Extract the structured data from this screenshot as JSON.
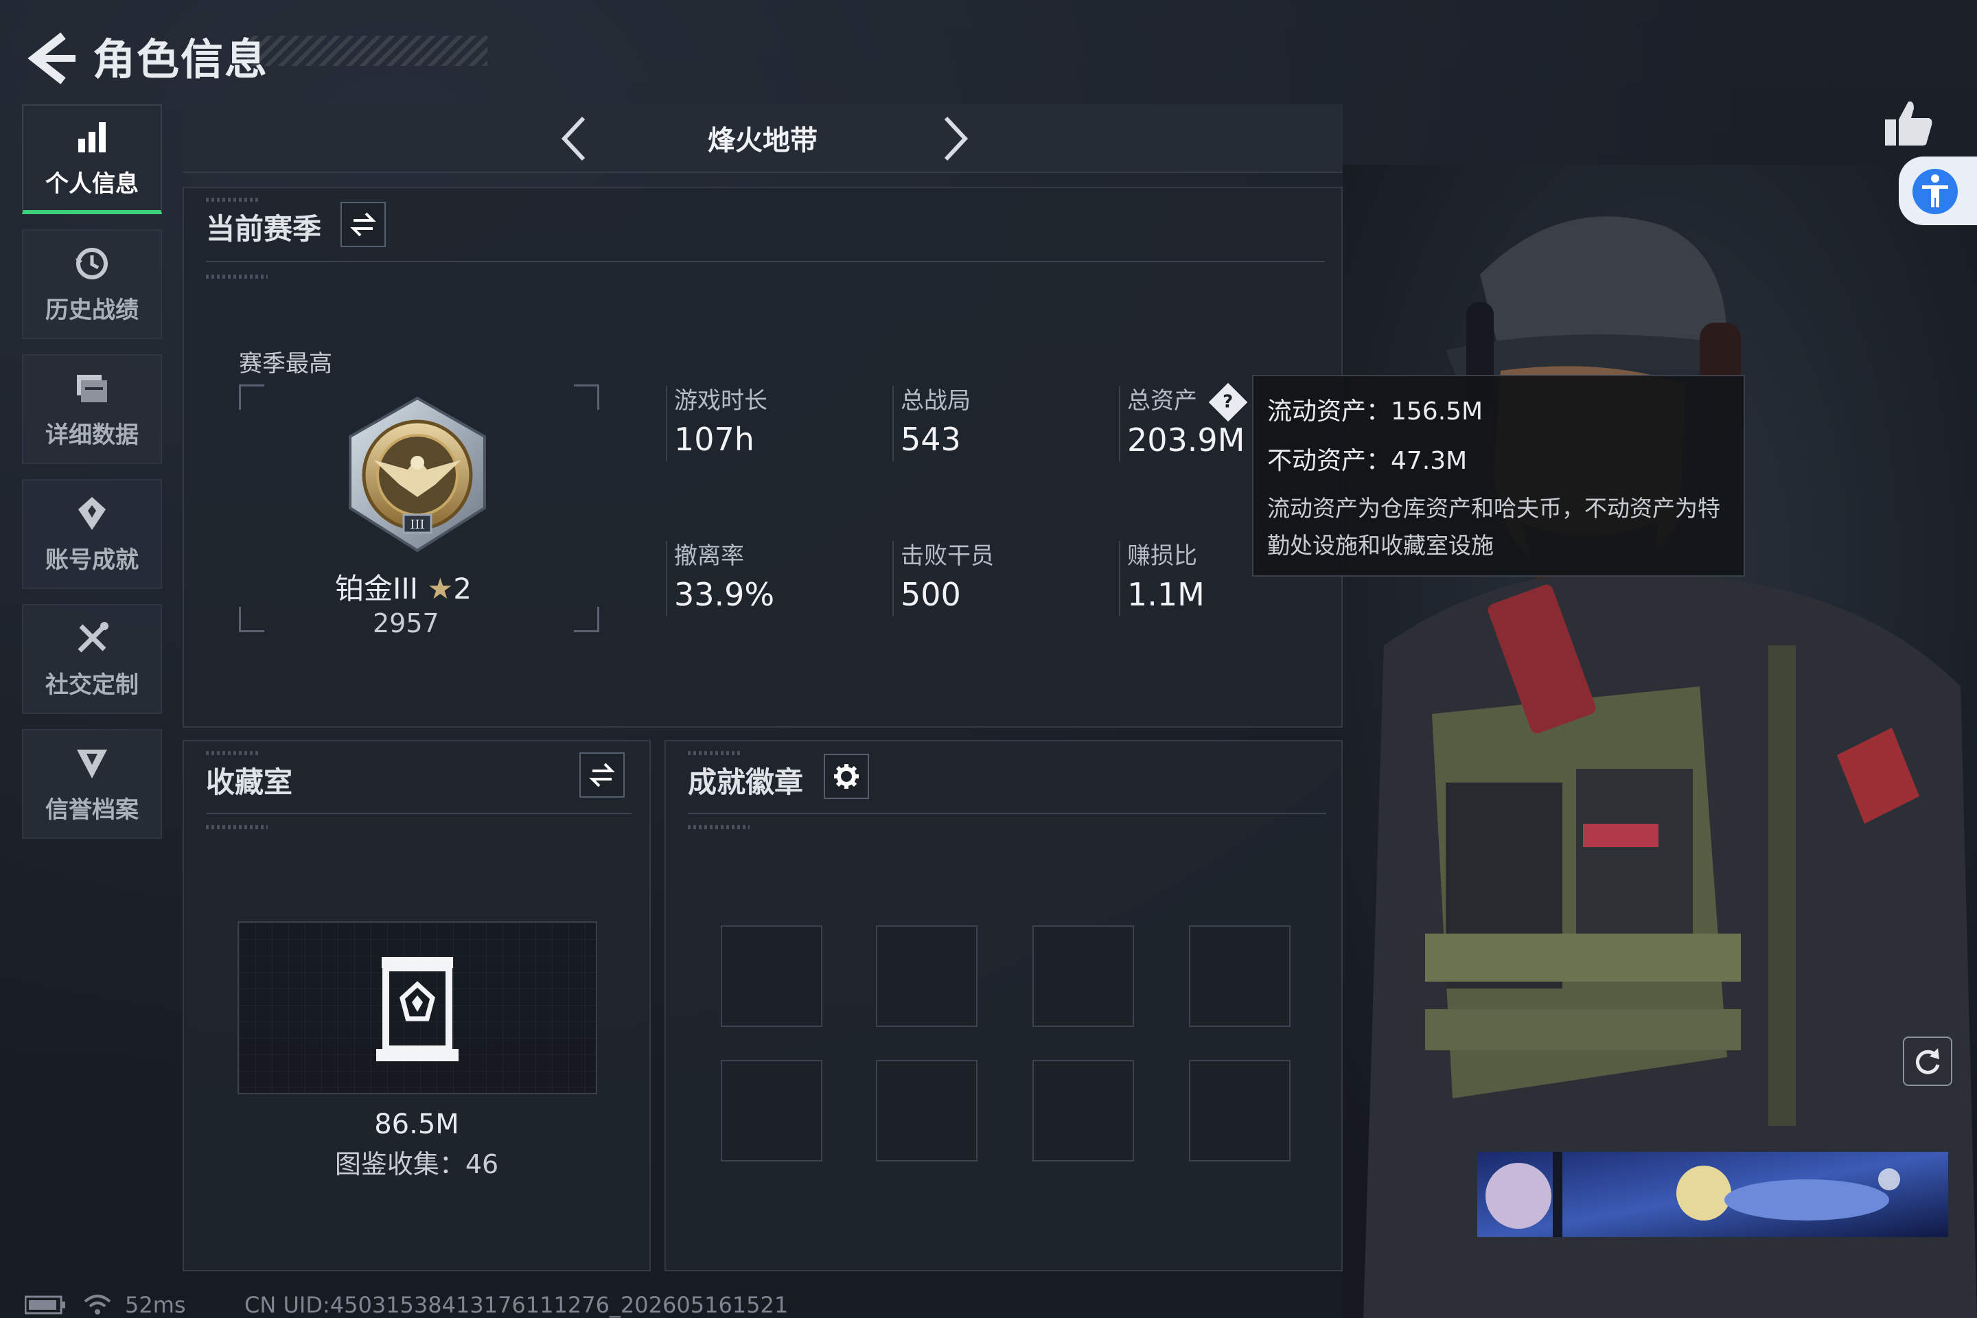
{
  "header": {
    "title": "角色信息"
  },
  "sidebar": {
    "items": [
      {
        "label": "个人信息",
        "icon": "bar-chart-icon",
        "active": true
      },
      {
        "label": "历史战绩",
        "icon": "history-clock-icon",
        "active": false
      },
      {
        "label": "详细数据",
        "icon": "folder-data-icon",
        "active": false
      },
      {
        "label": "账号成就",
        "icon": "achievement-badge-icon",
        "active": false
      },
      {
        "label": "社交定制",
        "icon": "tools-icon",
        "active": false
      },
      {
        "label": "信誉档案",
        "icon": "shield-down-icon",
        "active": false
      }
    ]
  },
  "mode": {
    "name": "烽火地带"
  },
  "season": {
    "title": "当前赛季",
    "best_label": "赛季最高",
    "rank": "铂金III",
    "stars": "2",
    "score": "2957",
    "stats": [
      {
        "label": "游戏时长",
        "value": "107h"
      },
      {
        "label": "总战局",
        "value": "543"
      },
      {
        "label": "总资产",
        "value": "203.9M"
      },
      {
        "label": "撤离率",
        "value": "33.9%"
      },
      {
        "label": "击败干员",
        "value": "500"
      },
      {
        "label": "赚损比",
        "value": "1.1M"
      }
    ]
  },
  "tooltip": {
    "liquid": "流动资产：156.5M",
    "fixed": "不动资产：47.3M",
    "desc": "流动资产为仓库资产和哈夫币，不动资产为特勤处设施和收藏室设施"
  },
  "collection": {
    "title": "收藏室",
    "value": "86.5M",
    "count": "图鉴收集：46"
  },
  "badges": {
    "title": "成就徽章",
    "slots": 8
  },
  "status": {
    "ping": "52ms",
    "uid": "CN UID:45031538413176111276_202605161521"
  },
  "colors": {
    "accent": "#3ed17b",
    "background": "#181d25",
    "panel": "#20252e",
    "access": "#2b7df0"
  }
}
